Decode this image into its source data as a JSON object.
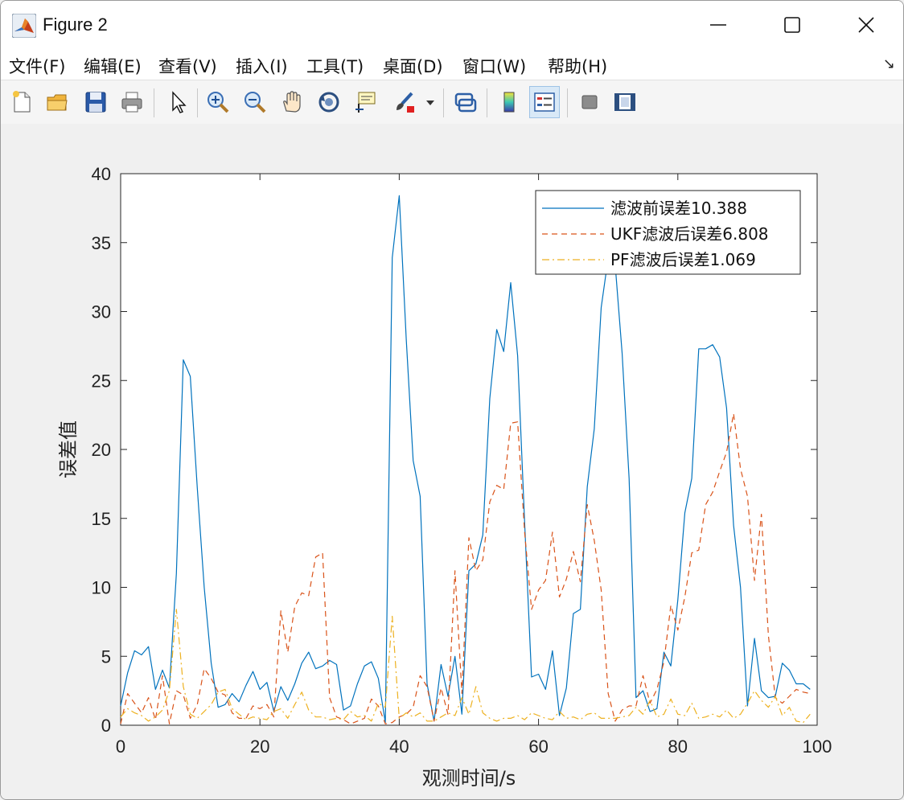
{
  "window": {
    "title": "Figure 2",
    "controls": [
      "minimize",
      "maximize",
      "close"
    ]
  },
  "menu": {
    "items": [
      "文件(F)",
      "编辑(E)",
      "查看(V)",
      "插入(I)",
      "工具(T)",
      "桌面(D)",
      "窗口(W)",
      "帮助(H)"
    ],
    "overflow_arrow": "↘"
  },
  "toolbar": {
    "buttons": [
      {
        "name": "new-figure-icon"
      },
      {
        "name": "open-file-icon"
      },
      {
        "name": "save-icon"
      },
      {
        "name": "print-icon"
      },
      {
        "name": "select-pointer-icon"
      },
      {
        "name": "zoom-in-icon"
      },
      {
        "name": "zoom-out-icon"
      },
      {
        "name": "pan-hand-icon"
      },
      {
        "name": "rotate-3d-icon"
      },
      {
        "name": "data-cursor-icon"
      },
      {
        "name": "brush-icon"
      },
      {
        "name": "link-plot-icon"
      },
      {
        "name": "colorbar-icon"
      },
      {
        "name": "legend-icon",
        "active": true
      },
      {
        "name": "hide-plot-tools-icon"
      },
      {
        "name": "show-plot-tools-icon"
      }
    ]
  },
  "chart_data": {
    "type": "line",
    "title": "",
    "xlabel": "观测时间/s",
    "ylabel": "误差值",
    "xlim": [
      0,
      100
    ],
    "ylim": [
      0,
      40
    ],
    "xticks": [
      0,
      20,
      40,
      60,
      80,
      100
    ],
    "yticks": [
      0,
      5,
      10,
      15,
      20,
      25,
      30,
      35,
      40
    ],
    "grid": false,
    "legend_position": "top-right",
    "x": [
      0,
      1,
      2,
      3,
      4,
      5,
      6,
      7,
      8,
      9,
      10,
      11,
      12,
      13,
      14,
      15,
      16,
      17,
      18,
      19,
      20,
      21,
      22,
      23,
      24,
      25,
      26,
      27,
      28,
      29,
      30,
      31,
      32,
      33,
      34,
      35,
      36,
      37,
      38,
      39,
      40,
      41,
      42,
      43,
      44,
      45,
      46,
      47,
      48,
      49,
      50,
      51,
      52,
      53,
      54,
      55,
      56,
      57,
      58,
      59,
      60,
      61,
      62,
      63,
      64,
      65,
      66,
      67,
      68,
      69,
      70,
      71,
      72,
      73,
      74,
      75,
      76,
      77,
      78,
      79,
      80,
      81,
      82,
      83,
      84,
      85,
      86,
      87,
      88,
      89,
      90,
      91,
      92,
      93,
      94,
      95,
      96,
      97,
      98,
      99
    ],
    "series": [
      {
        "name": "滤波前误差10.388",
        "color": "#0072BD",
        "style": "solid",
        "values": [
          1.4,
          3.8,
          5.4,
          5.1,
          5.7,
          2.6,
          4.0,
          2.7,
          11.0,
          26.5,
          25.3,
          17.2,
          10.0,
          4.5,
          1.3,
          1.5,
          2.3,
          1.7,
          2.9,
          3.9,
          2.6,
          3.1,
          1.0,
          2.8,
          1.8,
          3.0,
          4.5,
          5.3,
          4.1,
          4.3,
          4.7,
          4.4,
          1.1,
          1.4,
          3.0,
          4.3,
          4.6,
          3.4,
          0.2,
          33.9,
          38.4,
          28.0,
          19.2,
          16.6,
          3.0,
          0.3,
          4.4,
          2.1,
          5.0,
          0.8,
          11.2,
          11.7,
          13.8,
          23.7,
          28.7,
          27.1,
          32.1,
          26.8,
          14.7,
          3.5,
          3.7,
          2.6,
          5.4,
          0.7,
          2.7,
          8.1,
          8.4,
          17.3,
          21.5,
          30.3,
          33.9,
          33.4,
          27.0,
          17.9,
          2.0,
          2.5,
          1.0,
          1.2,
          5.3,
          4.3,
          9.1,
          15.4,
          17.9,
          27.3,
          27.3,
          27.6,
          26.7,
          23.0,
          14.5,
          10.0,
          1.4,
          6.3,
          2.5,
          2.0,
          2.1,
          4.5,
          4.0,
          3.0,
          3.0,
          2.6
        ]
      },
      {
        "name": "UKF滤波后误差6.808",
        "color": "#D95319",
        "style": "dashed",
        "values": [
          0.1,
          2.3,
          1.6,
          0.9,
          2.0,
          0.4,
          3.6,
          0.1,
          2.5,
          2.2,
          0.5,
          1.5,
          4.1,
          3.4,
          2.4,
          2.2,
          0.9,
          0.5,
          0.5,
          1.4,
          1.2,
          1.5,
          0.6,
          8.3,
          5.3,
          8.6,
          9.6,
          9.4,
          12.2,
          12.5,
          2.0,
          0.6,
          0.4,
          0.1,
          0.3,
          0.5,
          1.9,
          1.4,
          0.1,
          0.2,
          0.6,
          0.8,
          1.3,
          3.6,
          2.8,
          0.3,
          2.7,
          0.8,
          11.2,
          2.3,
          13.6,
          11.2,
          12.0,
          16.2,
          17.4,
          17.1,
          21.9,
          22.0,
          14.0,
          8.4,
          9.8,
          10.5,
          14.0,
          9.3,
          10.6,
          12.6,
          10.4,
          16.0,
          13.4,
          9.8,
          2.3,
          0.3,
          1.1,
          1.4,
          1.4,
          3.6,
          1.6,
          2.6,
          4.6,
          8.7,
          6.9,
          9.3,
          12.5,
          12.7,
          16.0,
          16.9,
          18.4,
          19.8,
          22.6,
          18.6,
          16.6,
          10.5,
          15.3,
          6.5,
          2.0,
          1.6,
          2.1,
          2.6,
          2.4,
          2.3
        ]
      },
      {
        "name": "PF滤波后误差1.069",
        "color": "#EDB120",
        "style": "dashdot",
        "values": [
          0.6,
          1.2,
          0.9,
          0.7,
          0.3,
          0.6,
          1.1,
          2.5,
          8.4,
          2.8,
          0.8,
          0.5,
          1.0,
          1.5,
          2.4,
          2.6,
          1.2,
          0.8,
          0.4,
          0.6,
          0.5,
          0.4,
          1.0,
          1.2,
          0.5,
          1.5,
          2.4,
          1.1,
          0.6,
          0.6,
          0.4,
          0.5,
          0.4,
          1.0,
          0.6,
          0.7,
          0.3,
          1.6,
          1.3,
          7.9,
          0.5,
          0.9,
          0.6,
          0.9,
          0.3,
          0.3,
          0.6,
          0.9,
          0.7,
          2.0,
          0.8,
          2.8,
          0.9,
          0.5,
          0.3,
          0.5,
          0.5,
          0.7,
          0.4,
          0.9,
          0.7,
          0.5,
          0.4,
          1.0,
          0.5,
          0.6,
          0.4,
          0.8,
          0.9,
          0.5,
          0.5,
          0.5,
          0.6,
          0.7,
          1.3,
          0.8,
          1.8,
          0.6,
          0.8,
          1.9,
          0.8,
          0.7,
          1.6,
          0.5,
          0.6,
          0.8,
          0.6,
          1.1,
          0.5,
          0.8,
          1.6,
          2.5,
          1.8,
          1.3,
          2.1,
          0.7,
          1.3,
          0.3,
          0.2,
          0.8
        ]
      }
    ]
  }
}
